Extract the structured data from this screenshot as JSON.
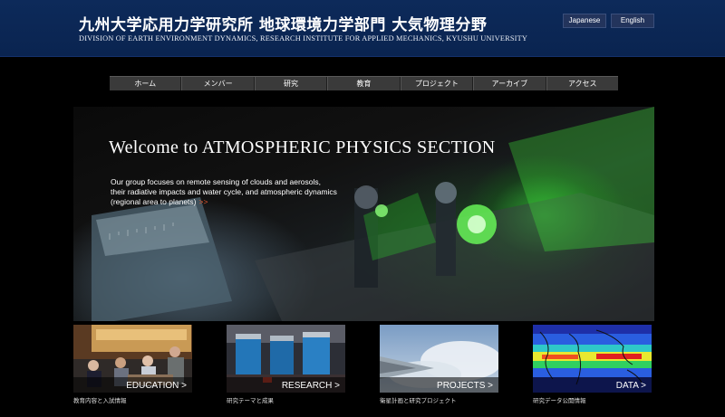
{
  "header": {
    "title": "九州大学応用力学研究所 地球環境力学部門 大気物理分野",
    "subtitle": "DIVISION OF EARTH ENVIRONMENT DYNAMICS, RESEARCH INSTITUTE FOR APPLIED MECHANICS, KYUSHU UNIVERSITY",
    "lang_japanese": "Japanese",
    "lang_english": "English",
    "color": "#0b2652"
  },
  "nav": {
    "items": [
      "ホーム",
      "メンバー",
      "研究",
      "教育",
      "プロジェクト",
      "アーカイブ",
      "アクセス"
    ]
  },
  "hero": {
    "title": "Welcome to ATMOSPHERIC PHYSICS SECTION",
    "line1": "Our group focuses on remote sensing of clouds and aerosols,",
    "line2": "their radiative impacts and  water cycle, and atmospheric dynamics",
    "line3": "(regional area to planets)",
    "more": ">>",
    "accent_color": "#e0552c"
  },
  "tiles": [
    {
      "label": "EDUCATION >",
      "caption": "教育内容と入試情報"
    },
    {
      "label": "RESEARCH >",
      "caption": "研究テーマと成果"
    },
    {
      "label": "PROJECTS >",
      "caption": "衛星計画と研究プロジェクト"
    },
    {
      "label": "DATA >",
      "caption": "研究データ公開情報"
    }
  ]
}
